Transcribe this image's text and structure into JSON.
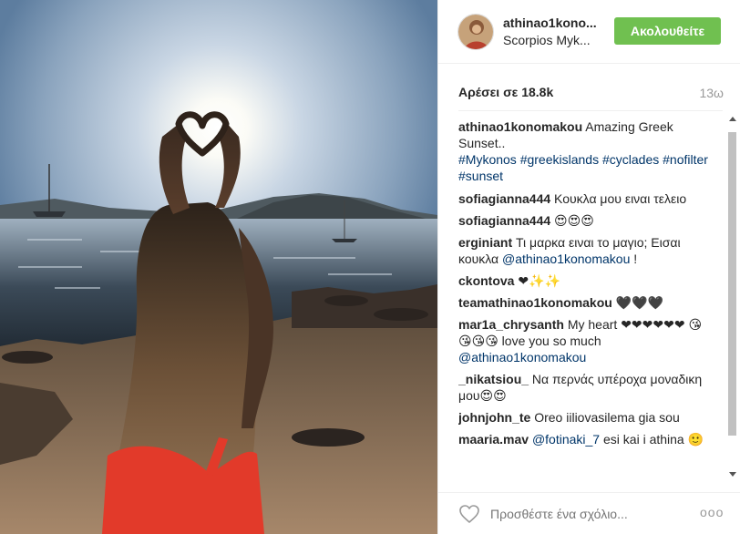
{
  "post": {
    "username": "athinao1kono...",
    "location": "Scorpios Myk...",
    "follow_label": "Ακολουθείτε",
    "likes": "Αρέσει σε 18.8k",
    "time": "13ω"
  },
  "comments": [
    {
      "user": "athinao1konomakou",
      "text": " Amazing Greek Sunset..",
      "tags": "#Mykonos #greekislands #cyclades #nofilter #sunset"
    },
    {
      "user": "sofiagianna444",
      "text": " Κουκλα μου ειναι τελειο"
    },
    {
      "user": "sofiagianna444",
      "text": " 😍😍😍"
    },
    {
      "user": "erginiant",
      "text": " Τι μαρκα ειναι το μαγιο; Εισαι κουκλα ",
      "mention": "@athinao1konomakou",
      "tail": " !"
    },
    {
      "user": "ckontova",
      "text": " ❤✨✨"
    },
    {
      "user": "teamathinao1konomakou",
      "text": " 🖤🖤🖤"
    },
    {
      "user": "mar1a_chrysanth",
      "text": " My heart ❤❤❤❤❤❤ 😘😘😘😘 love you so much ",
      "mention": "@athinao1konomakou"
    },
    {
      "user": "_nikatsiou_",
      "text": " Να περνάς υπέροχα μοναδικη μου😍😍"
    },
    {
      "user": "johnjohn_te",
      "text": " Oreo iiliovasilema gia sou"
    },
    {
      "user": "maaria.mav",
      "mention": "@fotinaki_7",
      "tail": " esi kai i athina 🙂"
    }
  ],
  "footer": {
    "comment_placeholder": "Προσθέστε ένα σχόλιο...",
    "more_label": "ooo"
  },
  "colors": {
    "follow": "#70c050",
    "link": "#003569"
  }
}
